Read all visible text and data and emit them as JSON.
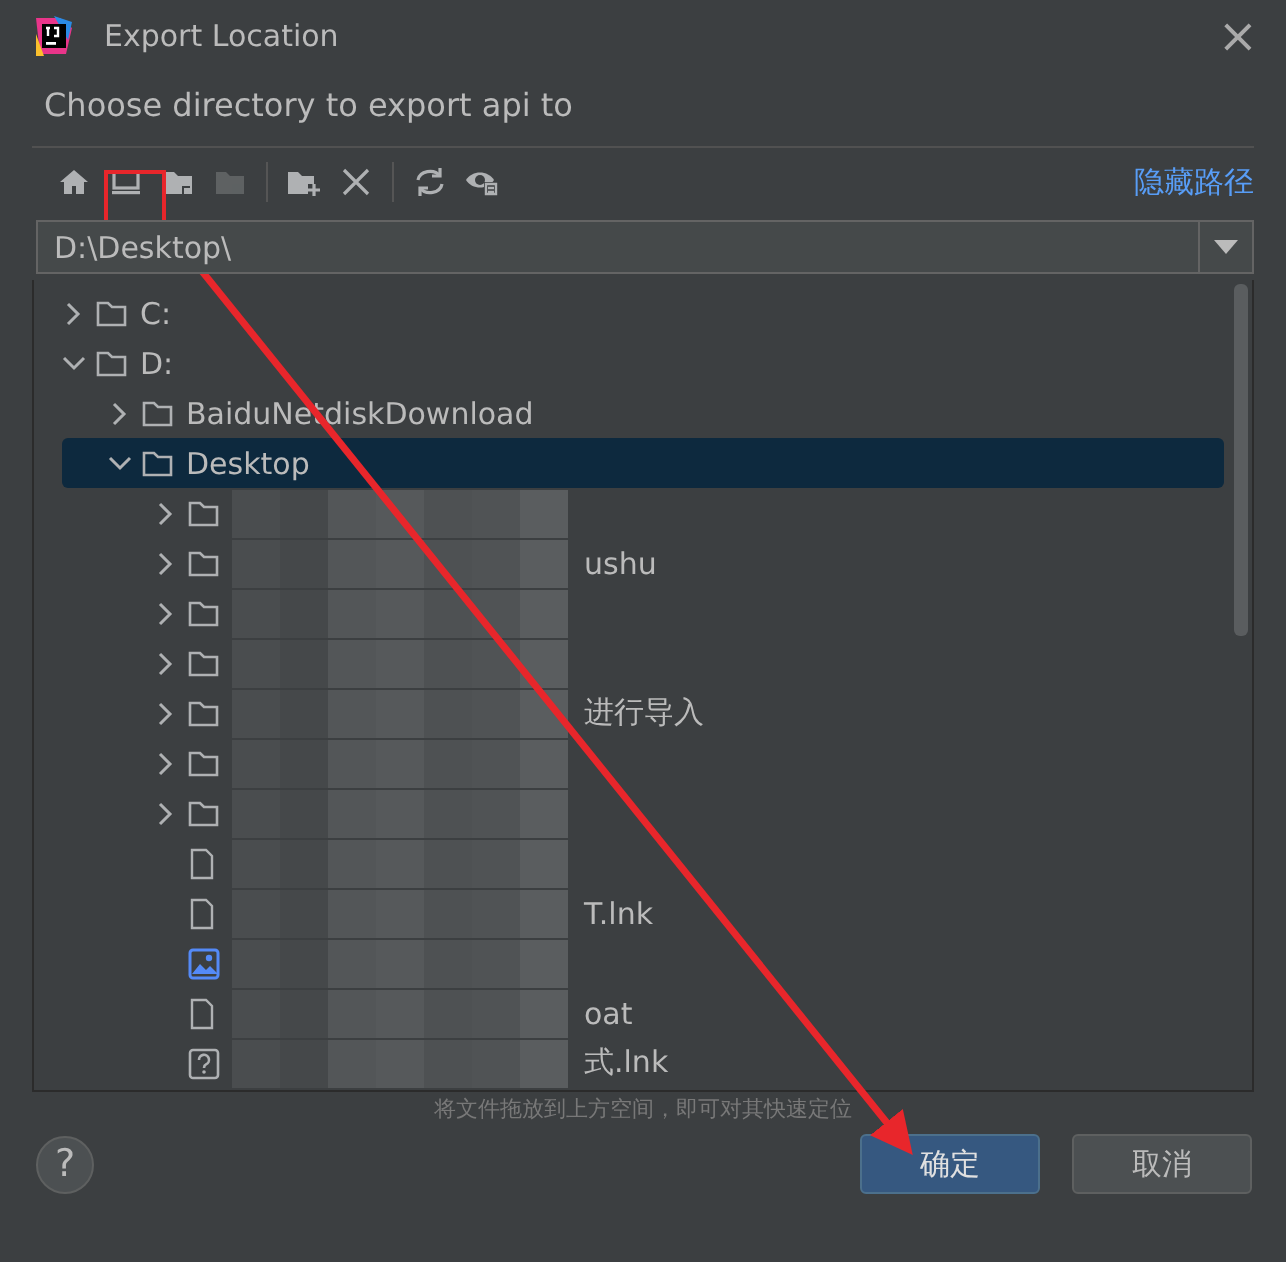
{
  "window": {
    "title": "Export Location",
    "close": "×"
  },
  "description": "Choose directory to export api to",
  "toolbar": {
    "items": [
      {
        "kind": "home",
        "disabled": false
      },
      {
        "kind": "desktop",
        "disabled": false
      },
      {
        "kind": "module",
        "disabled": false
      },
      {
        "kind": "folder",
        "disabled": true
      },
      {
        "kind": "sep"
      },
      {
        "kind": "newfolder",
        "disabled": false
      },
      {
        "kind": "delete",
        "disabled": false
      },
      {
        "kind": "sep"
      },
      {
        "kind": "refresh",
        "disabled": false
      },
      {
        "kind": "hidden",
        "disabled": false
      }
    ],
    "link": "隐藏路径"
  },
  "path_field": {
    "value": "D:\\Desktop\\"
  },
  "tree": [
    {
      "text": "C:",
      "kind": "folder",
      "expanded": false,
      "selected": false,
      "redacted": false
    },
    {
      "text": "D:",
      "kind": "folder",
      "expanded": true,
      "selected": false,
      "redacted": false,
      "children": [
        {
          "text": "BaiduNetdiskDownload",
          "kind": "folder",
          "expanded": false,
          "selected": false,
          "redacted": false
        },
        {
          "text": "Desktop",
          "kind": "folder",
          "expanded": true,
          "selected": true,
          "redacted": false,
          "children": [
            {
              "kind": "folder",
              "expanded": false,
              "selected": false,
              "redacted": true
            },
            {
              "text": "ushu",
              "kind": "folder",
              "expanded": false,
              "selected": false,
              "redacted": true
            },
            {
              "kind": "folder",
              "expanded": false,
              "selected": false,
              "redacted": true
            },
            {
              "kind": "folder",
              "expanded": false,
              "selected": false,
              "redacted": true
            },
            {
              "text": "进行导入",
              "kind": "folder",
              "expanded": false,
              "selected": false,
              "redacted": true
            },
            {
              "kind": "folder",
              "expanded": false,
              "selected": false,
              "redacted": true
            },
            {
              "kind": "folder",
              "expanded": false,
              "selected": false,
              "redacted": true
            },
            {
              "kind": "file",
              "selected": false,
              "redacted": true
            },
            {
              "text": "T.lnk",
              "kind": "file",
              "selected": false,
              "redacted": true
            },
            {
              "kind": "image",
              "selected": false,
              "redacted": true
            },
            {
              "text": "oat",
              "kind": "file",
              "selected": false,
              "redacted": true
            },
            {
              "text": "式.lnk",
              "kind": "unknown",
              "selected": false,
              "redacted": true
            }
          ]
        }
      ]
    }
  ],
  "hint": "将文件拖放到上方空间，即可对其快速定位",
  "help": "?",
  "buttons": [
    {
      "label": "确定",
      "primary": true
    },
    {
      "label": "取消",
      "primary": false
    }
  ]
}
